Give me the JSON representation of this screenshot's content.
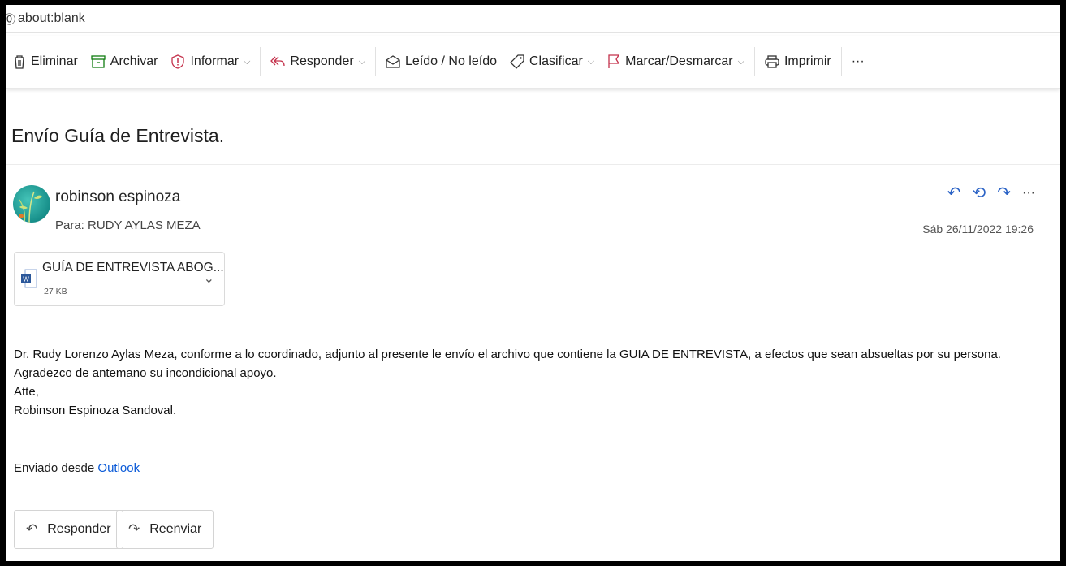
{
  "browser": {
    "url": "about:blank"
  },
  "toolbar": {
    "delete": "Eliminar",
    "archive": "Archivar",
    "report": "Informar",
    "reply": "Responder",
    "read_unread": "Leído / No leído",
    "categorize": "Clasificar",
    "flag": "Marcar/Desmarcar",
    "print": "Imprimir",
    "more": "···"
  },
  "email": {
    "subject": "Envío Guía de Entrevista.",
    "sender": "robinson espinoza",
    "to": "Para:  RUDY AYLAS MEZA",
    "date": "Sáb 26/11/2022 19:26",
    "attachment": {
      "name": "GUÍA DE ENTREVISTA ABOG...",
      "size": "27 KB"
    },
    "body": [
      "Dr. Rudy Lorenzo Aylas Meza, conforme a lo coordinado, adjunto al presente le envío el archivo que contiene la GUIA DE ENTREVISTA, a efectos que sean absueltas por su persona.",
      "Agradezco de antemano su incondicional apoyo.",
      "Atte,",
      "Robinson Espinoza Sandoval."
    ],
    "sent_from_prefix": "Enviado desde ",
    "sent_from_link": "Outlook"
  },
  "footer": {
    "reply": "Responder",
    "forward": "Reenviar"
  },
  "icons": {
    "delete": "trash-icon",
    "archive": "archive-icon",
    "report": "shield-alert-icon",
    "reply": "reply-all-icon",
    "read": "envelope-open-icon",
    "categorize": "tag-icon",
    "flag": "flag-icon",
    "print": "printer-icon"
  },
  "colors": {
    "accent": "#2b63c6",
    "link": "#0a5ad8",
    "flag": "#c4314b",
    "archive": "#107c10"
  }
}
